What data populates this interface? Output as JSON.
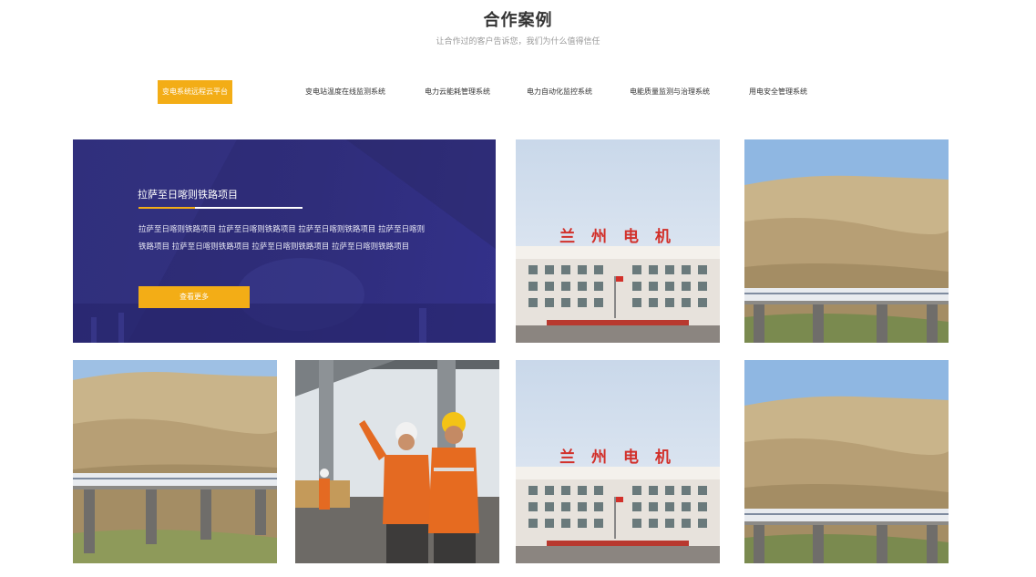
{
  "section": {
    "title": "合作案例",
    "subtitle": "让合作过的客户告诉您，我们为什么值得信任"
  },
  "tabs": [
    {
      "label": "变电系统远程云平台",
      "active": true
    },
    {
      "label": "变电站温度在线监测系统",
      "active": false
    },
    {
      "label": "电力云能耗管理系统",
      "active": false
    },
    {
      "label": "电力自动化监控系统",
      "active": false
    },
    {
      "label": "电能质量监测与治理系统",
      "active": false
    },
    {
      "label": "用电安全管理系统",
      "active": false
    }
  ],
  "feature": {
    "title": "拉萨至日喀则铁路项目",
    "description": "拉萨至日喀则铁路项目 拉萨至日喀则铁路项目 拉萨至日喀则铁路项目 拉萨至日喀则铁路项目 拉萨至日喀则铁路项目 拉萨至日喀则铁路项目 拉萨至日喀则铁路项目",
    "button_label": "查看更多"
  },
  "photos": {
    "building_sign": "兰 州 电 机"
  },
  "colors": {
    "accent": "#f3ad16",
    "feature_bg": "#2f2d7a"
  }
}
